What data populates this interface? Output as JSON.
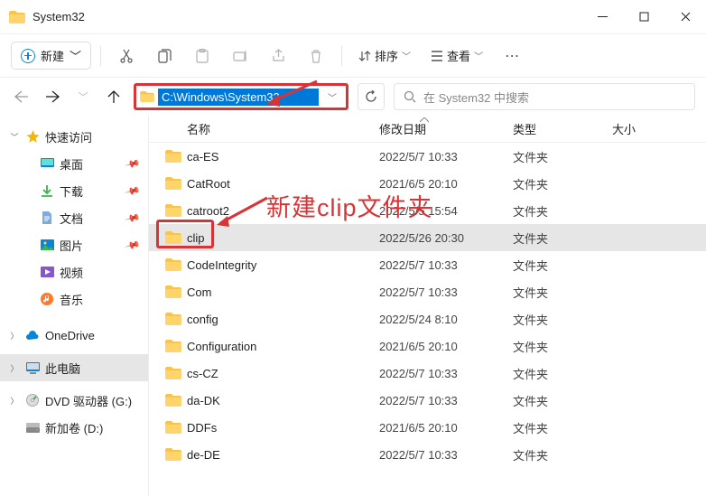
{
  "title": "System32",
  "toolbar": {
    "new": "新建",
    "sort": "排序",
    "view": "查看"
  },
  "address": "C:\\Windows\\System32",
  "search": {
    "placeholder": "在 System32 中搜索"
  },
  "sidebar": {
    "quick": "快速访问",
    "desktop": "桌面",
    "downloads": "下载",
    "documents": "文档",
    "pictures": "图片",
    "videos": "视频",
    "music": "音乐",
    "onedrive": "OneDrive",
    "thispc": "此电脑",
    "dvd": "DVD 驱动器 (G:)",
    "volume": "新加卷 (D:)"
  },
  "columns": {
    "name": "名称",
    "date": "修改日期",
    "type": "类型",
    "size": "大小"
  },
  "type_folder": "文件夹",
  "rows": [
    {
      "name": "ca-ES",
      "date": "2022/5/7 10:33"
    },
    {
      "name": "CatRoot",
      "date": "2021/6/5 20:10"
    },
    {
      "name": "catroot2",
      "date": "2022/5/5 15:54"
    },
    {
      "name": "clip",
      "date": "2022/5/26 20:30"
    },
    {
      "name": "CodeIntegrity",
      "date": "2022/5/7 10:33"
    },
    {
      "name": "Com",
      "date": "2022/5/7 10:33"
    },
    {
      "name": "config",
      "date": "2022/5/24 8:10"
    },
    {
      "name": "Configuration",
      "date": "2021/6/5 20:10"
    },
    {
      "name": "cs-CZ",
      "date": "2022/5/7 10:33"
    },
    {
      "name": "da-DK",
      "date": "2022/5/7 10:33"
    },
    {
      "name": "DDFs",
      "date": "2021/6/5 20:10"
    },
    {
      "name": "de-DE",
      "date": "2022/5/7 10:33"
    }
  ],
  "annotation": "新建clip文件夹"
}
